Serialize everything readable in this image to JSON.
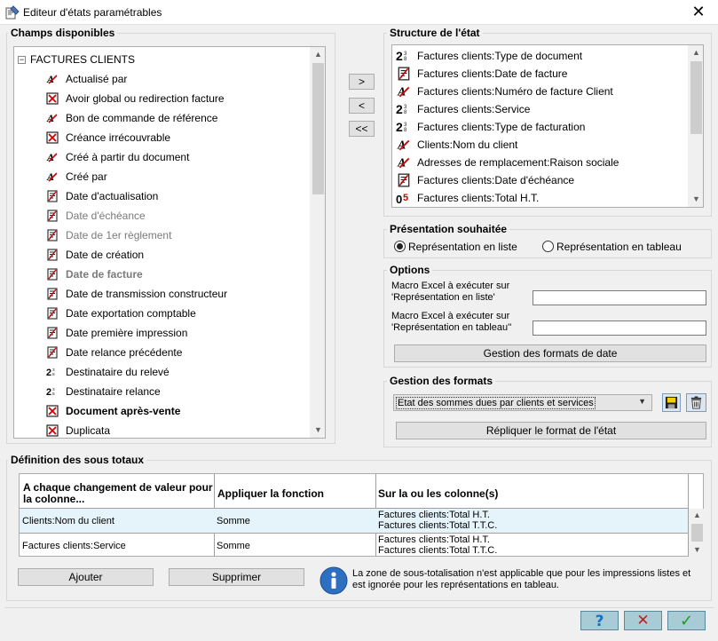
{
  "window": {
    "title": "Editeur d'états paramétrables",
    "close_glyph": "✕"
  },
  "champs": {
    "label": "Champs disponibles",
    "root": "FACTURES CLIENTS",
    "items": [
      {
        "label": "Actualisé par",
        "icon": "text-type-icon",
        "style": ""
      },
      {
        "label": "Avoir global ou redirection facture",
        "icon": "checkbox-type-icon",
        "style": ""
      },
      {
        "label": "Bon de commande de référence",
        "icon": "text-type-icon",
        "style": ""
      },
      {
        "label": "Créance irrécouvrable",
        "icon": "checkbox-type-icon",
        "style": ""
      },
      {
        "label": "Créé à partir du document",
        "icon": "text-type-icon",
        "style": ""
      },
      {
        "label": "Créé par",
        "icon": "text-type-icon",
        "style": ""
      },
      {
        "label": "Date d'actualisation",
        "icon": "date-type-icon",
        "style": ""
      },
      {
        "label": "Date d'échéance",
        "icon": "date-type-icon",
        "style": "grey"
      },
      {
        "label": "Date de 1er règlement",
        "icon": "date-type-icon",
        "style": "grey"
      },
      {
        "label": "Date de création",
        "icon": "date-type-icon",
        "style": ""
      },
      {
        "label": "Date de facture",
        "icon": "date-type-icon",
        "style": "grey bold"
      },
      {
        "label": "Date de transmission constructeur",
        "icon": "date-type-icon",
        "style": ""
      },
      {
        "label": "Date exportation comptable",
        "icon": "date-type-icon",
        "style": ""
      },
      {
        "label": "Date première impression",
        "icon": "date-type-icon",
        "style": ""
      },
      {
        "label": "Date relance précédente",
        "icon": "date-type-icon",
        "style": ""
      },
      {
        "label": "Destinataire du relevé",
        "icon": "code-type-icon",
        "style": ""
      },
      {
        "label": "Destinataire relance",
        "icon": "code-type-icon",
        "style": ""
      },
      {
        "label": "Document après-vente",
        "icon": "checkbox-type-icon",
        "style": "bold"
      },
      {
        "label": "Duplicata",
        "icon": "checkbox-type-icon",
        "style": ""
      }
    ]
  },
  "move_buttons": {
    "add": ">",
    "remove": "<",
    "remove_all": "<<"
  },
  "structure": {
    "label": "Structure de l'état",
    "items": [
      {
        "label": "Factures clients:Type de document",
        "icon": "code-type-icon"
      },
      {
        "label": "Factures clients:Date de facture",
        "icon": "date-type-icon"
      },
      {
        "label": "Factures clients:Numéro de facture Client",
        "icon": "text-type-icon"
      },
      {
        "label": "Factures clients:Service",
        "icon": "code-type-icon"
      },
      {
        "label": "Factures clients:Type de facturation",
        "icon": "code-type-icon"
      },
      {
        "label": "Clients:Nom du client",
        "icon": "text-type-icon"
      },
      {
        "label": "Adresses de remplacement:Raison sociale",
        "icon": "text-type-icon"
      },
      {
        "label": "Factures clients:Date d'échéance",
        "icon": "date-type-icon"
      },
      {
        "label": "Factures clients:Total H.T.",
        "icon": "number-type-icon"
      }
    ]
  },
  "presentation": {
    "label": "Présentation souhaitée",
    "option_list": "Représentation en liste",
    "option_table": "Représentation en tableau"
  },
  "options": {
    "label": "Options",
    "macro_list_line1": "Macro Excel à exécuter sur",
    "macro_list_line2": "'Représentation en liste'",
    "macro_list_value": "",
    "macro_table_line1": "Macro Excel à exécuter sur",
    "macro_table_line2": "'Représentation en tableau''",
    "macro_table_value": "",
    "date_formats_button": "Gestion des formats de date"
  },
  "formats": {
    "label": "Gestion des formats",
    "selected": "Etat des sommes dues par clients et services",
    "replicate_button": "Répliquer le format de l'état"
  },
  "subtotals": {
    "label": "Définition des sous totaux",
    "headers": {
      "col1": "A chaque changement de valeur pour la colonne...",
      "col2": "Appliquer la fonction",
      "col3": "Sur la  ou les colonne(s)"
    },
    "rows": [
      {
        "column": "Clients:Nom du client",
        "function": "Somme",
        "targets": [
          "Factures clients:Total H.T.",
          "Factures clients:Total T.T.C."
        ]
      },
      {
        "column": "Factures clients:Service",
        "function": "Somme",
        "targets": [
          "Factures clients:Total H.T.",
          "Factures clients:Total T.T.C."
        ]
      }
    ],
    "add_button": "Ajouter",
    "remove_button": "Supprimer",
    "info_text": "La zone de sous-totalisation n'est applicable que pour les impressions listes et est ignorée pour les représentations en tableau."
  },
  "footer": {
    "help": "?",
    "cancel": "✕",
    "ok": "✓"
  },
  "colors": {
    "selected_row": "#e5f3fb",
    "cancel_red": "#c0201a",
    "ok_green": "#1e9a1e",
    "help_blue": "#1b6fc0"
  }
}
